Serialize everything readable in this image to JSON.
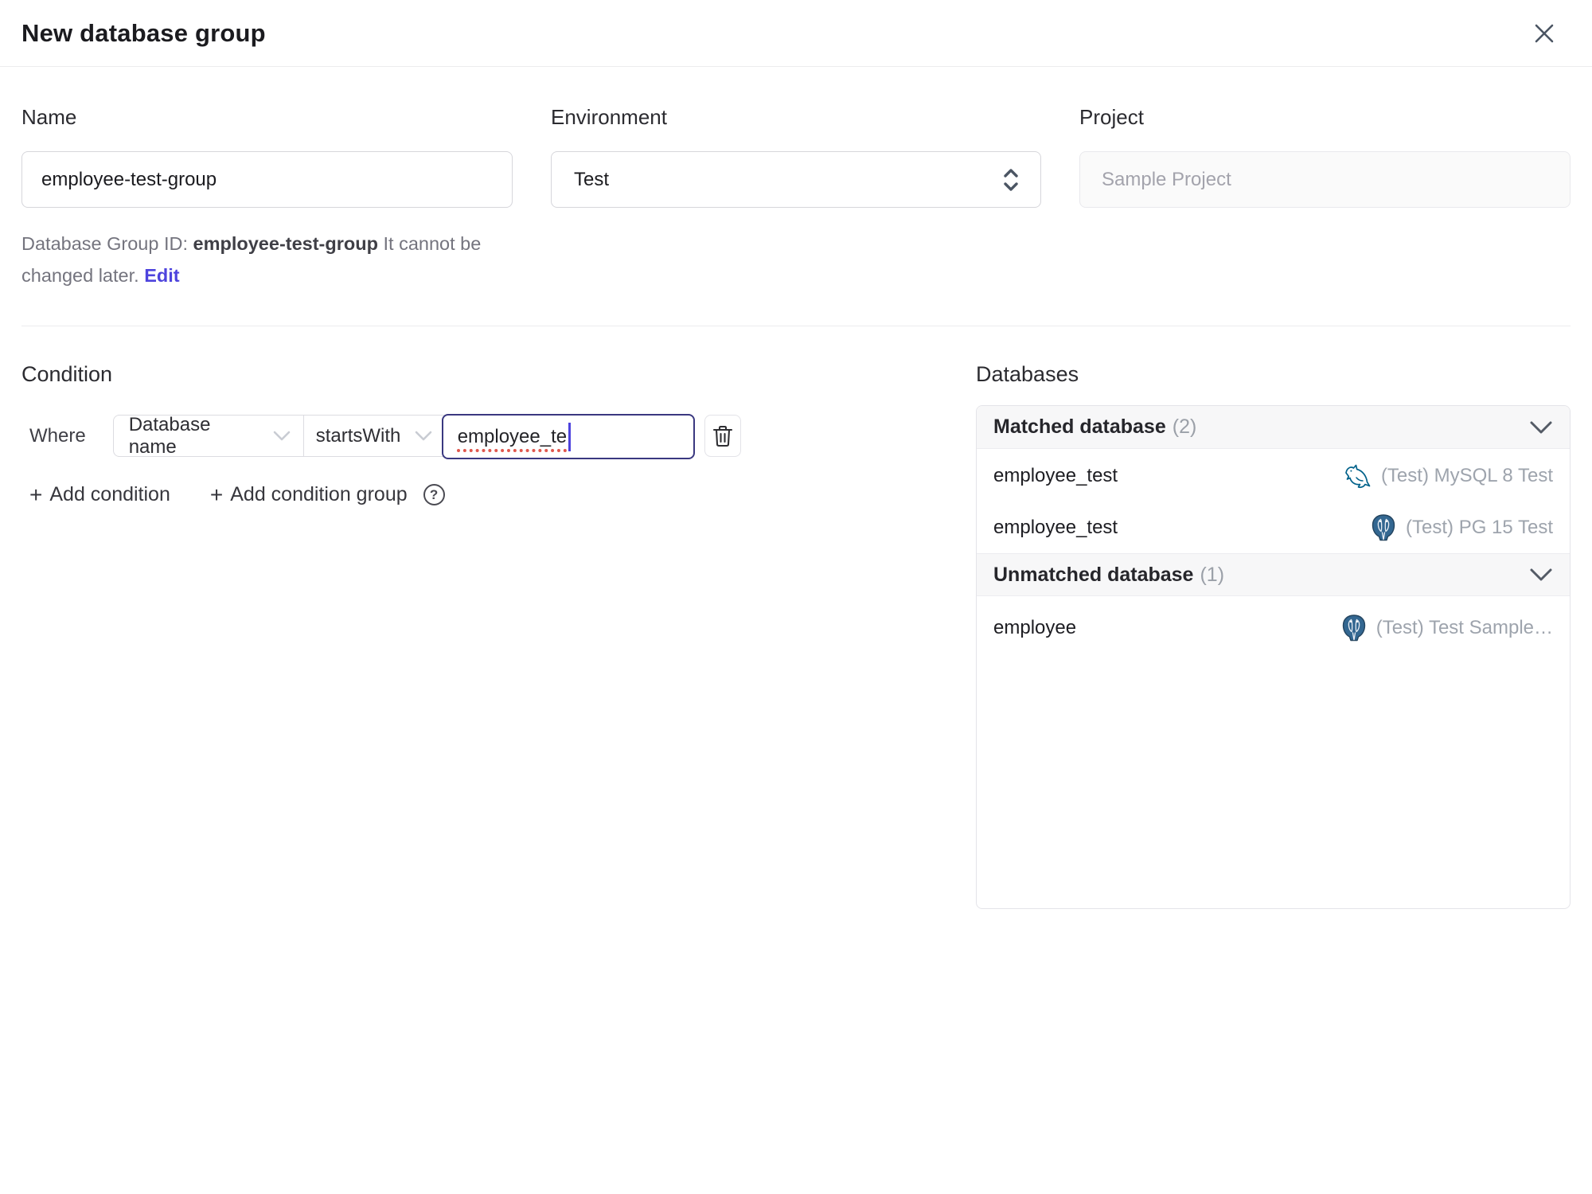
{
  "colors": {
    "accent": "#4d43dd",
    "focus_border": "#3a3880",
    "spellcheck_underline": "#e0584e",
    "mysql_icon": "#00618a",
    "postgres_icon": "#336791",
    "muted_text": "#9ea4ad",
    "header_bg": "#f7f7f8"
  },
  "header": {
    "title": "New database group",
    "close_icon": "x"
  },
  "form": {
    "name": {
      "label": "Name",
      "value": "employee-test-group"
    },
    "environment": {
      "label": "Environment",
      "selected": "Test"
    },
    "project": {
      "label": "Project",
      "value": "Sample Project"
    },
    "helper": {
      "prefix": "Database Group ID: ",
      "id": "employee-test-group",
      "suffix": " It cannot be changed later.",
      "edit_label": "Edit"
    }
  },
  "condition": {
    "heading": "Condition",
    "where_label": "Where",
    "factor": "Database name",
    "operator": "startsWith",
    "pattern_value": "employee_te",
    "add_condition_label": "Add condition",
    "add_condition_group_label": "Add condition group",
    "plus_glyph": "+",
    "help_glyph": "?"
  },
  "databases": {
    "heading": "Databases",
    "matched": {
      "title": "Matched database",
      "count": "(2)",
      "rows": [
        {
          "name": "employee_test",
          "engine": "mysql",
          "instance": "(Test) MySQL 8 Test"
        },
        {
          "name": "employee_test",
          "engine": "postgres",
          "instance": "(Test) PG 15 Test"
        }
      ]
    },
    "unmatched": {
      "title": "Unmatched database",
      "count": "(1)",
      "rows": [
        {
          "name": "employee",
          "engine": "postgres",
          "instance": "(Test) Test Sample…"
        }
      ]
    }
  }
}
